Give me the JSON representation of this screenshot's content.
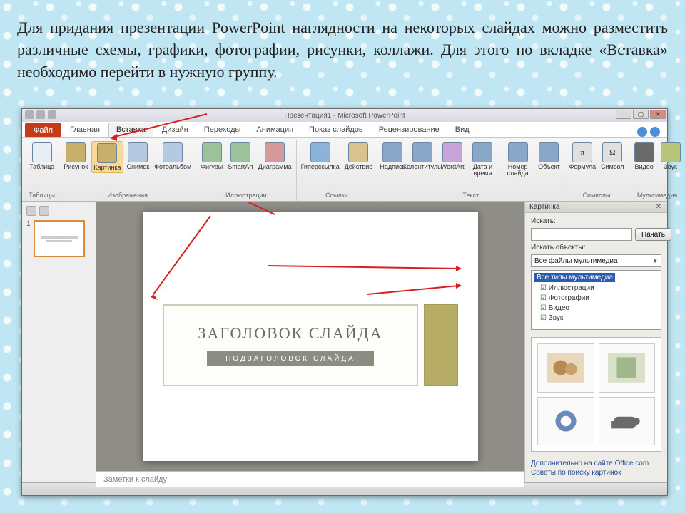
{
  "caption": "Для придания презентации PowerPoint наглядности на некоторых слайдах можно разместить различные схемы, графики, фотографии, рисунки, коллажи. Для этого по вкладке «Вставка» необходимо перейти в нужную группу.",
  "window": {
    "title": "Презентация1 - Microsoft PowerPoint",
    "file_tab": "Файл",
    "tabs": [
      "Главная",
      "Вставка",
      "Дизайн",
      "Переходы",
      "Анимация",
      "Показ слайдов",
      "Рецензирование",
      "Вид"
    ],
    "active_tab_index": 1
  },
  "ribbon": {
    "groups": [
      {
        "label": "Таблицы",
        "items": [
          "Таблица"
        ]
      },
      {
        "label": "Изображения",
        "items": [
          "Рисунок",
          "Картинка",
          "Снимок",
          "Фотоальбом"
        ],
        "active_index": 1
      },
      {
        "label": "Иллюстрации",
        "items": [
          "Фигуры",
          "SmartArt",
          "Диаграмма"
        ]
      },
      {
        "label": "Ссылки",
        "items": [
          "Гиперссылка",
          "Действие"
        ]
      },
      {
        "label": "Текст",
        "items": [
          "Надпись",
          "Колонтитулы",
          "WordArt",
          "Дата и время",
          "Номер слайда",
          "Объект"
        ]
      },
      {
        "label": "Символы",
        "items": [
          "Формула",
          "Символ"
        ]
      },
      {
        "label": "Мультимедиа",
        "items": [
          "Видео",
          "Звук"
        ]
      }
    ]
  },
  "slide": {
    "number": "1",
    "title": "ЗАГОЛОВОК СЛАЙДА",
    "subtitle": "ПОДЗАГОЛОВОК СЛАЙДА",
    "notes_placeholder": "Заметки к слайду"
  },
  "clipart": {
    "pane_title": "Картинка",
    "search_label": "Искать:",
    "search_value": "",
    "search_button": "Начать",
    "objects_label": "Искать объекты:",
    "objects_value": "Все файлы мультимедиа",
    "tree_root": "Все типы мультимедиа",
    "tree_items": [
      "Иллюстрации",
      "Фотографии",
      "Видео",
      "Звук"
    ],
    "footer_links": [
      "Дополнительно на сайте Office.com",
      "Советы по поиску картинок"
    ]
  }
}
